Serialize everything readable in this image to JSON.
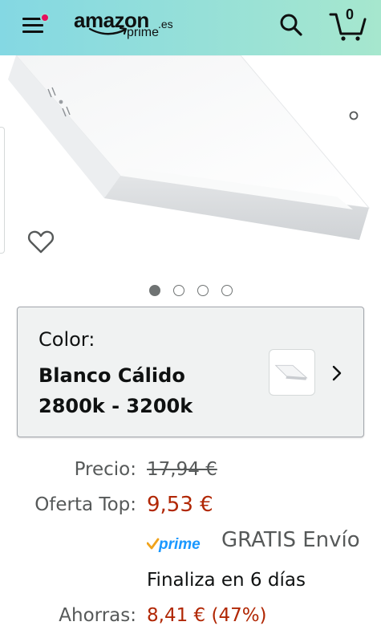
{
  "header": {
    "logo_word": "amazon",
    "logo_tld": ".es",
    "logo_prime": "prime",
    "cart_count": "0",
    "colors": {
      "gradient_start": "#84d8e3",
      "gradient_end": "#a6e7ce",
      "notification_dot": "#e60e5c"
    },
    "icons": [
      "menu-icon",
      "search-icon",
      "cart-icon"
    ]
  },
  "gallery": {
    "dot_count": 4,
    "active_dot": 0,
    "icons": [
      "heart-icon"
    ]
  },
  "variation": {
    "label": "Color:",
    "value_line1": "Blanco Cálido",
    "value_line2": "2800k - 3200k",
    "icons": [
      "chevron-right-icon"
    ]
  },
  "pricing": {
    "list_price_label": "Precio:",
    "list_price": "17,94 €",
    "deal_label": "Oferta Top:",
    "deal_price": "9,53 €",
    "prime_badge": "prime",
    "shipping": "GRATIS Envío",
    "deal_end": "Finaliza en 6 días",
    "savings_label": "Ahorras:",
    "savings": "8,41 € (47%)",
    "colors": {
      "deal": "#b12704",
      "muted": "#565959",
      "prime_check": "#f0a31c",
      "prime_word": "#1a98ff"
    }
  }
}
